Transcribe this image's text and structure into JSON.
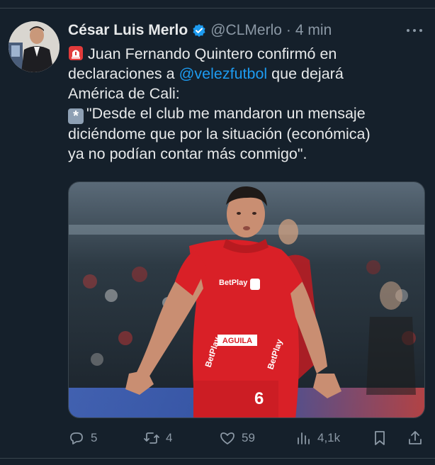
{
  "tweet": {
    "author": {
      "display_name": "César Luis Merlo",
      "handle": "@CLMerlo",
      "verified": true
    },
    "separator": "·",
    "time": "4 min",
    "lines": {
      "l1": "Juan Fernando Quintero confirmó en",
      "l2_before": "declaraciones a ",
      "l2_mention": "@velezfutbol",
      "l2_after": " que dejará",
      "l3": "América de Cali:",
      "l4": "\"Desde el club me mandaron un mensaje",
      "l5": "diciéndome que por la situación (económica)",
      "l6": "ya no podían contar más conmigo\"."
    },
    "media": {
      "jersey_sponsor": "AGUILA",
      "sleeve_sponsor": "BetPlay",
      "shorts_number": "6"
    },
    "metrics": {
      "replies": "5",
      "retweets": "4",
      "likes": "59",
      "views": "4,1k"
    }
  },
  "icons": {
    "reply": "reply-icon",
    "retweet": "retweet-icon",
    "like": "like-icon",
    "views": "views-icon",
    "bookmark": "bookmark-icon",
    "share": "share-icon",
    "more": "more-icon",
    "verified": "verified-badge-icon",
    "siren": "siren-emoji-icon",
    "asterisk": "asterisk-emoji-icon"
  },
  "colors": {
    "background": "#15202b",
    "text": "#e7e9ea",
    "secondary": "#8b98a5",
    "link": "#1d9bf0",
    "jersey": "#d92027"
  }
}
